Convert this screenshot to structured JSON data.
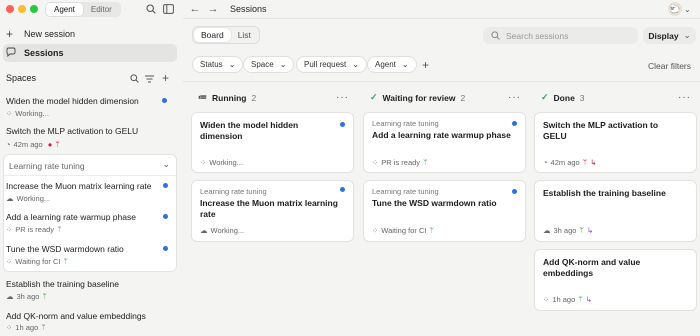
{
  "window": {
    "dot_colors": [
      "#ff5f57",
      "#febc2e",
      "#28c840"
    ]
  },
  "mode_tabs": {
    "agent": "Agent",
    "editor": "Editor"
  },
  "sidebar": {
    "new_session": "New session",
    "sessions": "Sessions",
    "spaces_title": "Spaces",
    "items": [
      {
        "title": "Widen the model hidden dimension",
        "status": "Working..."
      },
      {
        "title": "Switch the MLP activation to GELU",
        "status": "42m ago"
      }
    ],
    "group": {
      "name": "Learning rate tuning",
      "items": [
        {
          "title": "Increase the Muon matrix learning rate",
          "status": "Working..."
        },
        {
          "title": "Add a learning rate warmup phase",
          "status": "PR is ready"
        },
        {
          "title": "Tune the WSD warmdown ratio",
          "status": "Waiting for CI"
        }
      ]
    },
    "more_items": [
      {
        "title": "Establish the training baseline",
        "status": "3h ago"
      },
      {
        "title": "Add QK-norm and value embeddings",
        "status": "1h ago"
      }
    ]
  },
  "topbar": {
    "title": "Sessions"
  },
  "view_tabs": {
    "board": "Board",
    "list": "List"
  },
  "search": {
    "placeholder": "Search sessions"
  },
  "display_button": "Display",
  "filters": {
    "status": "Status",
    "space": "Space",
    "pull_request": "Pull request",
    "agent": "Agent",
    "clear": "Clear filters"
  },
  "columns": [
    {
      "title": "Running",
      "count": "2",
      "cards": [
        {
          "group": "",
          "title": "Widen the model hidden dimension",
          "status": "Working..."
        },
        {
          "group": "Learning rate tuning",
          "title": "Increase the Muon matrix learning rate",
          "status": "Working..."
        }
      ]
    },
    {
      "title": "Waiting for review",
      "count": "2",
      "cards": [
        {
          "group": "Learning rate tuning",
          "title": "Add a learning rate warmup phase",
          "status": "PR is ready"
        },
        {
          "group": "Learning rate tuning",
          "title": "Tune the WSD warmdown ratio",
          "status": "Waiting for CI"
        }
      ]
    },
    {
      "title": "Done",
      "count": "3",
      "cards": [
        {
          "group": "",
          "title": "Switch the MLP activation to GELU",
          "status": "42m ago"
        },
        {
          "group": "",
          "title": "Establish the training baseline",
          "status": "3h ago"
        },
        {
          "group": "",
          "title": "Add QK-norm and value embeddings",
          "status": "1h ago"
        }
      ]
    }
  ],
  "colors": {
    "accent_blue": "#2f6fe0",
    "done_green": "#3aa655",
    "merge_red": "#d14",
    "merge_purple": "#8a4cc9"
  }
}
